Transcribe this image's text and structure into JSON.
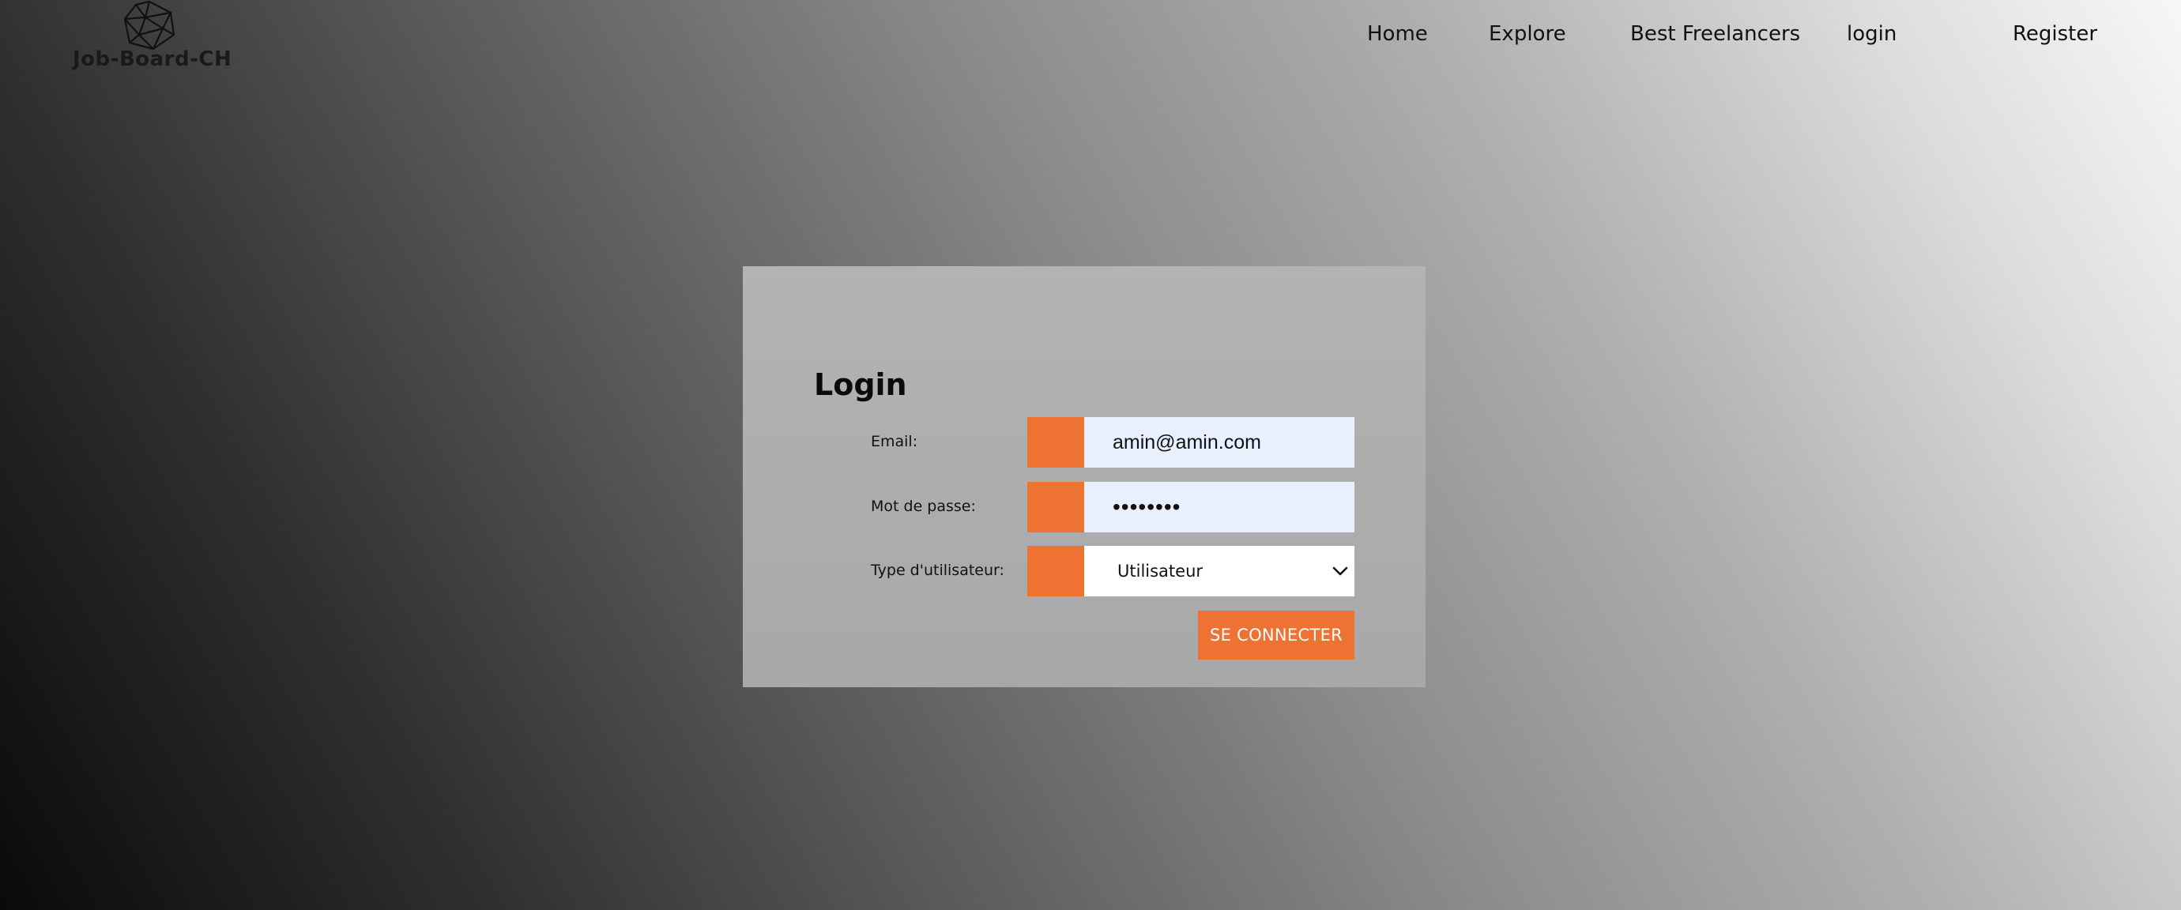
{
  "header": {
    "logo_text": "Job-Board-CH",
    "nav": {
      "home": "Home",
      "explore": "Explore",
      "best_freelancers": "Best Freelancers",
      "login": "login",
      "register": "Register"
    }
  },
  "form": {
    "title": "Login",
    "email": {
      "label": "Email:",
      "value": "amin@amin.com"
    },
    "password": {
      "label": "Mot de passe:",
      "masked_value": "••••••••"
    },
    "user_type": {
      "label": "Type d'utilisateur:",
      "selected": "Utilisateur"
    },
    "submit_label": "SE CONNECTER"
  },
  "colors": {
    "accent": "#ee7332",
    "autofill_bg": "#e8f0fe",
    "card_bg": "#aaaaaa"
  }
}
